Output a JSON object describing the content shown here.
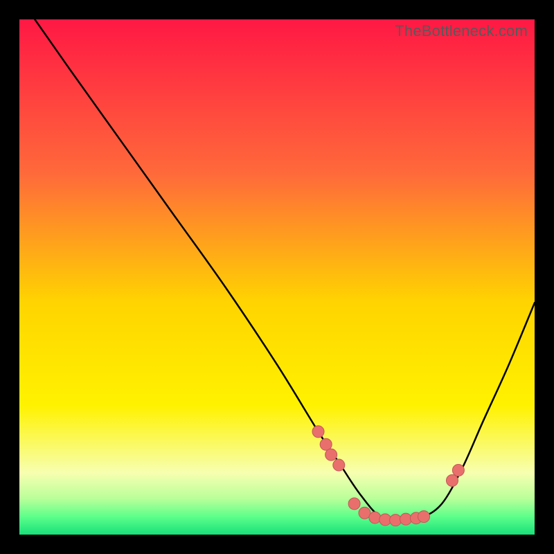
{
  "watermark": "TheBottleneck.com",
  "colors": {
    "frame_bg": "#000000",
    "curve": "#000000",
    "dot_fill": "#e96f6d",
    "dot_stroke": "#c25755",
    "grad_top": "#ff1844",
    "grad_mid1": "#ff6a3a",
    "grad_mid2": "#ffd400",
    "grad_mid3": "#fff200",
    "grad_low": "#f7ffb0",
    "grad_base1": "#b9ff9a",
    "grad_base2": "#5dff8a",
    "grad_bottom": "#18e07a"
  },
  "chart_data": {
    "type": "line",
    "title": "",
    "xlabel": "",
    "ylabel": "",
    "xlim": [
      0,
      100
    ],
    "ylim": [
      0,
      100
    ],
    "series": [
      {
        "name": "bottleneck-curve",
        "x": [
          3,
          10,
          20,
          30,
          40,
          50,
          58,
          62,
          66,
          70,
          74,
          78,
          82,
          86,
          90,
          95,
          100
        ],
        "y": [
          100,
          90,
          76,
          62,
          48,
          33,
          20,
          14,
          8,
          3.5,
          2.8,
          3.3,
          6,
          13,
          22,
          33,
          45
        ]
      }
    ],
    "markers": {
      "name": "highlight-dots",
      "x": [
        58,
        59.5,
        60.5,
        62,
        65,
        67,
        69,
        71,
        73,
        75,
        77,
        78.5,
        84,
        85.2
      ],
      "y": [
        20,
        17.5,
        15.5,
        13.5,
        6.0,
        4.2,
        3.3,
        2.9,
        2.8,
        3.0,
        3.2,
        3.5,
        10.5,
        12.5
      ]
    }
  }
}
